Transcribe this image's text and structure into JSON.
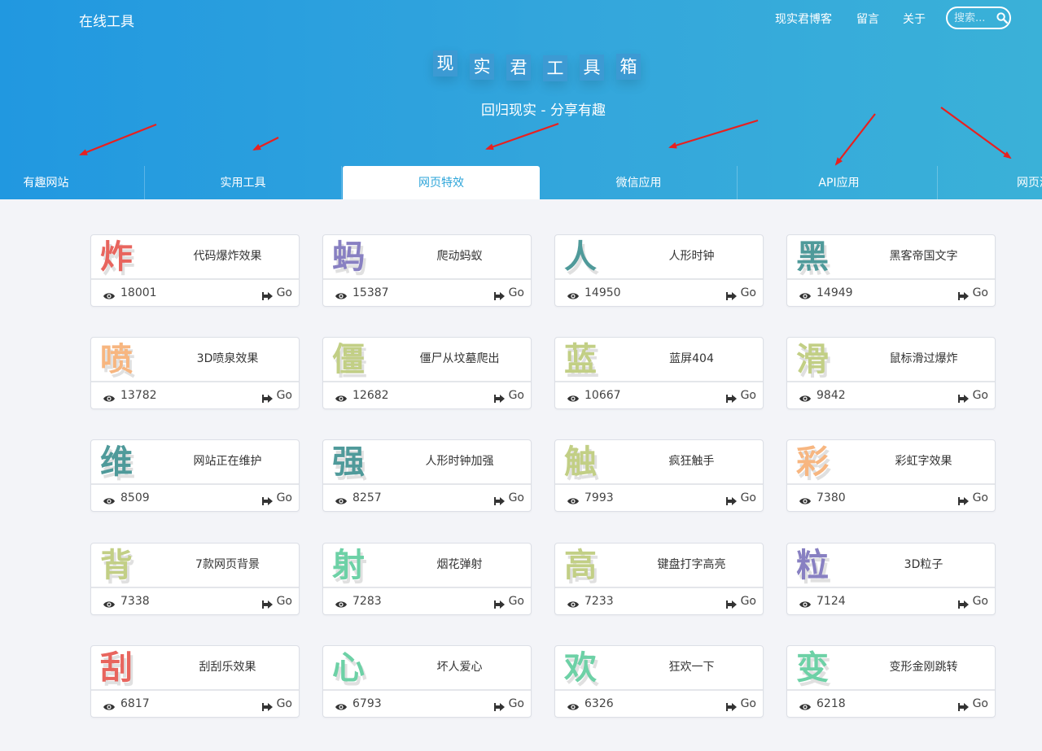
{
  "header": {
    "brand": "在线工具",
    "nav": [
      {
        "label": "现实君博客"
      },
      {
        "label": "留言"
      },
      {
        "label": "关于"
      }
    ],
    "search_placeholder": "搜索...",
    "title_chars": [
      "现",
      "实",
      "君",
      "工",
      "具",
      "箱"
    ],
    "tagline": "回归现实 - 分享有趣",
    "tabs": [
      {
        "label": "有趣网站"
      },
      {
        "label": "实用工具"
      },
      {
        "label": "网页特效",
        "active": true
      },
      {
        "label": "微信应用"
      },
      {
        "label": "API应用"
      },
      {
        "label": "网页游戏"
      }
    ],
    "gradient": [
      "#2198e0",
      "#3ab1d8"
    ],
    "arrow_color": "#e8201f",
    "active_tab_color": "#2ea5d9"
  },
  "cards": [
    {
      "char": "炸",
      "color": "#e8655e",
      "title": "代码爆炸效果",
      "views": "18001",
      "go": "Go"
    },
    {
      "char": "蚂",
      "color": "#8880c2",
      "title": "爬动蚂蚁",
      "views": "15387",
      "go": "Go"
    },
    {
      "char": "人",
      "color": "#4f9a9a",
      "title": "人形时钟",
      "views": "14950",
      "go": "Go"
    },
    {
      "char": "黑",
      "color": "#4f9a9a",
      "title": "黑客帝国文字",
      "views": "14949",
      "go": "Go"
    },
    {
      "char": "喷",
      "color": "#f7b680",
      "title": "3D喷泉效果",
      "views": "13782",
      "go": "Go"
    },
    {
      "char": "僵",
      "color": "#c2cf85",
      "title": "僵尸从坟墓爬出",
      "views": "12682",
      "go": "Go"
    },
    {
      "char": "蓝",
      "color": "#c2cf85",
      "title": "蓝屏404",
      "views": "10667",
      "go": "Go"
    },
    {
      "char": "滑",
      "color": "#c2cf85",
      "title": "鼠标滑过爆炸",
      "views": "9842",
      "go": "Go"
    },
    {
      "char": "维",
      "color": "#4f9a9a",
      "title": "网站正在维护",
      "views": "8509",
      "go": "Go"
    },
    {
      "char": "强",
      "color": "#4f9a9a",
      "title": "人形时钟加强",
      "views": "8257",
      "go": "Go"
    },
    {
      "char": "触",
      "color": "#c2cf85",
      "title": "疯狂触手",
      "views": "7993",
      "go": "Go"
    },
    {
      "char": "彩",
      "color": "#f7b680",
      "title": "彩虹字效果",
      "views": "7380",
      "go": "Go"
    },
    {
      "char": "背",
      "color": "#c2cf85",
      "title": "7款网页背景",
      "views": "7338",
      "go": "Go"
    },
    {
      "char": "射",
      "color": "#6dd1a6",
      "title": "烟花弹射",
      "views": "7283",
      "go": "Go"
    },
    {
      "char": "高",
      "color": "#c2cf85",
      "title": "键盘打字高亮",
      "views": "7233",
      "go": "Go"
    },
    {
      "char": "粒",
      "color": "#8880c2",
      "title": "3D粒子",
      "views": "7124",
      "go": "Go"
    },
    {
      "char": "刮",
      "color": "#e8655e",
      "title": "刮刮乐效果",
      "views": "6817",
      "go": "Go"
    },
    {
      "char": "心",
      "color": "#6dd1a6",
      "title": "坏人爱心",
      "views": "6793",
      "go": "Go"
    },
    {
      "char": "欢",
      "color": "#6dd1a6",
      "title": "狂欢一下",
      "views": "6326",
      "go": "Go"
    },
    {
      "char": "变",
      "color": "#6dd1a6",
      "title": "变形金刚跳转",
      "views": "6218",
      "go": "Go"
    }
  ]
}
